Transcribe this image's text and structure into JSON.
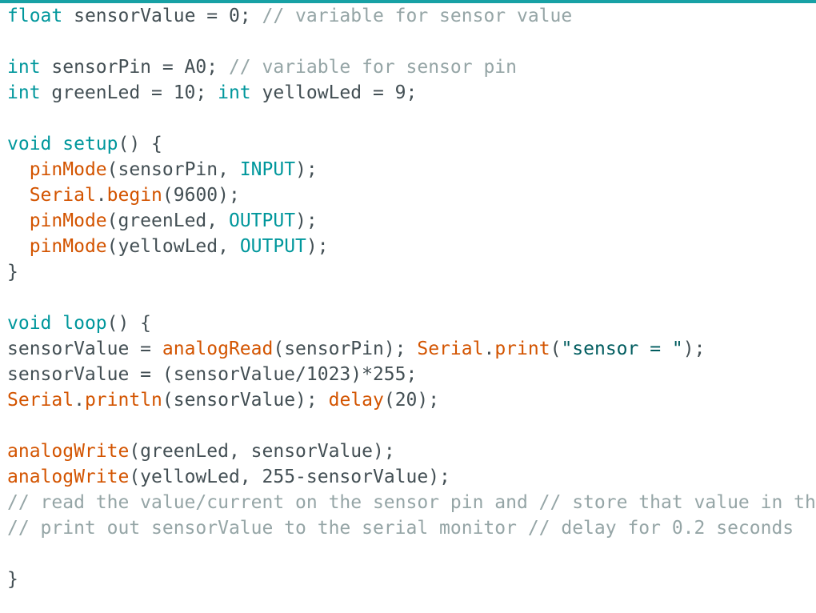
{
  "editor": {
    "colors": {
      "default": "#434f54",
      "keyword": "#00979c",
      "function": "#d35400",
      "comment": "#95a5a6",
      "string": "#005c5f",
      "accent": "#17a1a5"
    },
    "lines": [
      [
        {
          "t": "float",
          "c": "keyword"
        },
        {
          "t": " sensorValue = 0; ",
          "c": "default"
        },
        {
          "t": "// variable for sensor value",
          "c": "comment"
        }
      ],
      [],
      [
        {
          "t": "int",
          "c": "keyword"
        },
        {
          "t": " sensorPin = A0; ",
          "c": "default"
        },
        {
          "t": "// variable for sensor pin",
          "c": "comment"
        }
      ],
      [
        {
          "t": "int",
          "c": "keyword"
        },
        {
          "t": " greenLed = 10; ",
          "c": "default"
        },
        {
          "t": "int",
          "c": "keyword"
        },
        {
          "t": " yellowLed = 9;",
          "c": "default"
        }
      ],
      [],
      [
        {
          "t": "void",
          "c": "keyword"
        },
        {
          "t": " ",
          "c": "default"
        },
        {
          "t": "setup",
          "c": "keyword"
        },
        {
          "t": "() {",
          "c": "default"
        }
      ],
      [
        {
          "t": "  ",
          "c": "default"
        },
        {
          "t": "pinMode",
          "c": "function"
        },
        {
          "t": "(sensorPin, ",
          "c": "default"
        },
        {
          "t": "INPUT",
          "c": "keyword"
        },
        {
          "t": ");",
          "c": "default"
        }
      ],
      [
        {
          "t": "  ",
          "c": "default"
        },
        {
          "t": "Serial",
          "c": "function"
        },
        {
          "t": ".",
          "c": "default"
        },
        {
          "t": "begin",
          "c": "function"
        },
        {
          "t": "(9600);",
          "c": "default"
        }
      ],
      [
        {
          "t": "  ",
          "c": "default"
        },
        {
          "t": "pinMode",
          "c": "function"
        },
        {
          "t": "(greenLed, ",
          "c": "default"
        },
        {
          "t": "OUTPUT",
          "c": "keyword"
        },
        {
          "t": ");",
          "c": "default"
        }
      ],
      [
        {
          "t": "  ",
          "c": "default"
        },
        {
          "t": "pinMode",
          "c": "function"
        },
        {
          "t": "(yellowLed, ",
          "c": "default"
        },
        {
          "t": "OUTPUT",
          "c": "keyword"
        },
        {
          "t": ");",
          "c": "default"
        }
      ],
      [
        {
          "t": "}",
          "c": "default"
        }
      ],
      [],
      [
        {
          "t": "void",
          "c": "keyword"
        },
        {
          "t": " ",
          "c": "default"
        },
        {
          "t": "loop",
          "c": "keyword"
        },
        {
          "t": "() {",
          "c": "default"
        }
      ],
      [
        {
          "t": "sensorValue = ",
          "c": "default"
        },
        {
          "t": "analogRead",
          "c": "function"
        },
        {
          "t": "(sensorPin); ",
          "c": "default"
        },
        {
          "t": "Serial",
          "c": "function"
        },
        {
          "t": ".",
          "c": "default"
        },
        {
          "t": "print",
          "c": "function"
        },
        {
          "t": "(",
          "c": "default"
        },
        {
          "t": "\"sensor = \"",
          "c": "string"
        },
        {
          "t": ");",
          "c": "default"
        }
      ],
      [
        {
          "t": "sensorValue = (sensorValue/1023)*255;",
          "c": "default"
        }
      ],
      [
        {
          "t": "Serial",
          "c": "function"
        },
        {
          "t": ".",
          "c": "default"
        },
        {
          "t": "println",
          "c": "function"
        },
        {
          "t": "(sensorValue); ",
          "c": "default"
        },
        {
          "t": "delay",
          "c": "function"
        },
        {
          "t": "(20);",
          "c": "default"
        }
      ],
      [],
      [
        {
          "t": "analogWrite",
          "c": "function"
        },
        {
          "t": "(greenLed, sensorValue);",
          "c": "default"
        }
      ],
      [
        {
          "t": "analogWrite",
          "c": "function"
        },
        {
          "t": "(yellowLed, 255-sensorValue);",
          "c": "default"
        }
      ],
      [
        {
          "t": "// read the value/current on the sensor pin and // store that value in th",
          "c": "comment"
        }
      ],
      [
        {
          "t": "// print out sensorValue to the serial monitor // delay for 0.2 seconds",
          "c": "comment"
        }
      ],
      [],
      [
        {
          "t": "}",
          "c": "default"
        }
      ]
    ]
  }
}
